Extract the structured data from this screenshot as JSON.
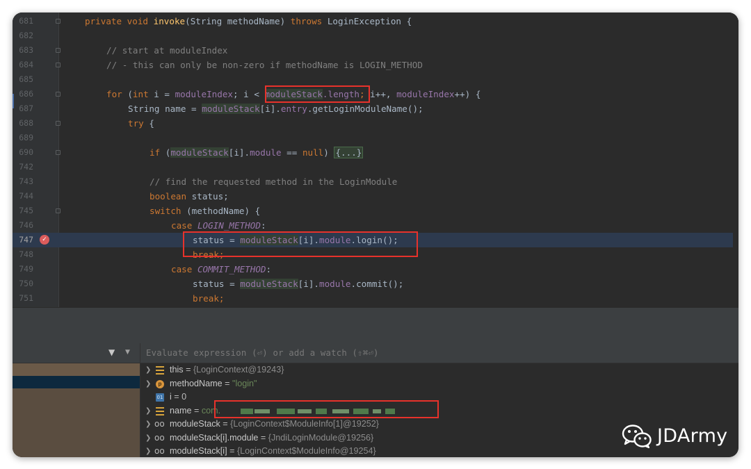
{
  "editor": {
    "lines": [
      {
        "n": "681"
      },
      {
        "n": "682"
      },
      {
        "n": "683"
      },
      {
        "n": "684"
      },
      {
        "n": "685"
      },
      {
        "n": "686"
      },
      {
        "n": "687"
      },
      {
        "n": "688"
      },
      {
        "n": "689"
      },
      {
        "n": "690"
      },
      {
        "n": "742"
      },
      {
        "n": "743"
      },
      {
        "n": "744"
      },
      {
        "n": "745"
      },
      {
        "n": "746"
      },
      {
        "n": "747"
      },
      {
        "n": "748"
      },
      {
        "n": "749"
      },
      {
        "n": "750"
      },
      {
        "n": "751"
      }
    ],
    "code": {
      "l681": {
        "private": "private",
        "void": "void",
        "name": "invoke",
        "args": "(String methodName) ",
        "throws": "throws",
        "tail": " LoginException {"
      },
      "l683": "// start at moduleIndex",
      "l684": "// - this can only be non-zero if methodName is LOGIN_METHOD",
      "l686": {
        "for": "for",
        "p1": " (",
        "int": "int",
        "p2": " i = ",
        "mi": "moduleIndex",
        "p3": "; i < ",
        "ms": "moduleStack",
        "len": ".length",
        "sc": ";",
        "p4": " i++, ",
        "mi2": "moduleIndex",
        "p5": "++) {"
      },
      "l687": {
        "p1": "String name = ",
        "ms": "moduleStack",
        "p2": "[i].",
        "entry": "entry",
        "p3": ".getLoginModuleName();"
      },
      "l688": {
        "try": "try",
        "p1": " {"
      },
      "l690": {
        "if": "if",
        "p1": " (",
        "ms": "moduleStack",
        "p2": "[i].",
        "module": "module",
        "p3": " == ",
        "null": "null",
        "p4": ") ",
        "collapsed": "{...}"
      },
      "l743": "// find the requested method in the LoginModule",
      "l744": {
        "boolean": "boolean",
        "p1": " status;"
      },
      "l745": {
        "switch": "switch",
        "p1": " (methodName) {"
      },
      "l746": {
        "case": "case",
        "const": "LOGIN_METHOD",
        "colon": ":"
      },
      "l747": {
        "p1": "status = ",
        "ms": "moduleStack",
        "p2": "[i].",
        "module": "module",
        "p3": ".login();"
      },
      "l748": "break;",
      "l749": {
        "case": "case",
        "const": "COMMIT_METHOD",
        "colon": ":"
      },
      "l750": {
        "p1": "status = ",
        "ms": "moduleStack",
        "p2": "[i].",
        "module": "module",
        "p3": ".commit();"
      },
      "l751": "break;"
    }
  },
  "debugger": {
    "eval_placeholder": "Evaluate expression (⏎) or add a watch (⇧⌘⏎)",
    "variables": [
      {
        "name": "this",
        "value": "{LoginContext@19243}",
        "icon": "field-icon"
      },
      {
        "name": "methodName",
        "value": "\"login\"",
        "icon": "param-icon"
      },
      {
        "name": "i",
        "value": "0",
        "icon": "primitive-icon"
      },
      {
        "name": "name",
        "value": "com.",
        "icon": "field-icon"
      },
      {
        "name": "moduleStack",
        "value": "{LoginContext$ModuleInfo[1]@19252}",
        "icon": "watch-icon"
      },
      {
        "name": "moduleStack[i].module",
        "value": "{JndiLoginModule@19256}",
        "icon": "watch-icon"
      },
      {
        "name": "moduleStack[i]",
        "value": "{LoginContext$ModuleInfo@19254}",
        "icon": "watch-icon"
      }
    ],
    "equals": " = ",
    "primitive_badge": "01",
    "param_badge": "p"
  },
  "watermark": {
    "text": "JDArmy",
    "icon": "wechat-icon"
  },
  "colors": {
    "highlight_box": "#e8322b",
    "keyword": "#cc7832",
    "string": "#6a8759",
    "field": "#9876aa"
  }
}
